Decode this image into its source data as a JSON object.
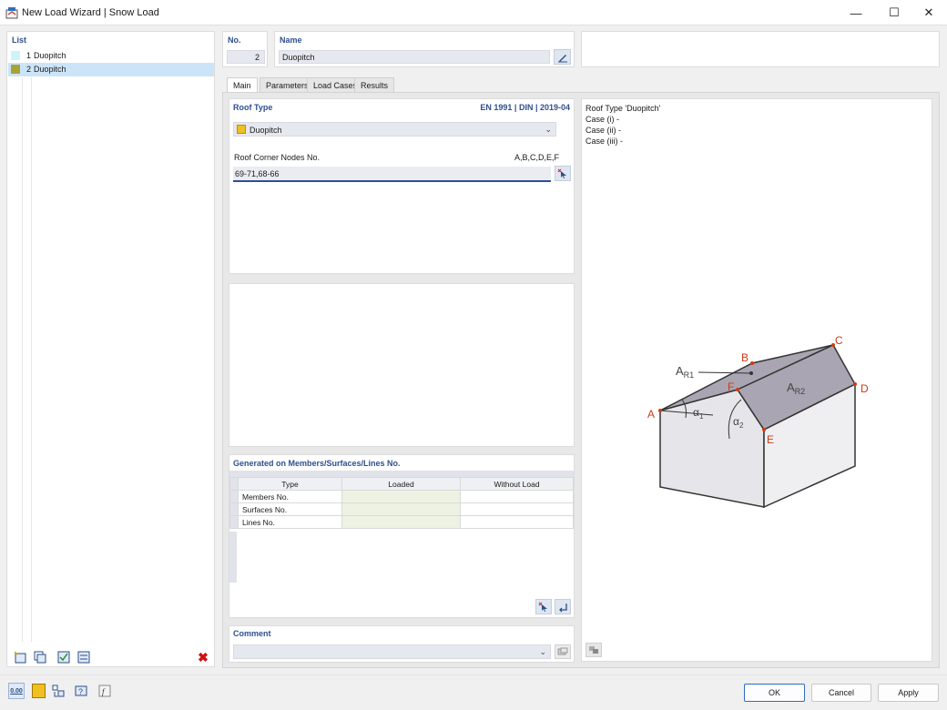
{
  "window": {
    "title": "New Load Wizard | Snow Load",
    "controls": {
      "minimize": "—",
      "maximize": "☐",
      "close": "✕"
    }
  },
  "list": {
    "header": "List",
    "items": [
      {
        "num": "1",
        "label": "Duopitch",
        "color": "#ccf5fb",
        "selected": false
      },
      {
        "num": "2",
        "label": "Duopitch",
        "color": "#a8a23a",
        "selected": true
      }
    ]
  },
  "fields": {
    "no_label": "No.",
    "no_value": "2",
    "name_label": "Name",
    "name_value": "Duopitch"
  },
  "tabs": [
    {
      "label": "Main",
      "active": true
    },
    {
      "label": "Parameters",
      "active": false
    },
    {
      "label": "Load Cases",
      "active": false
    },
    {
      "label": "Results",
      "active": false
    }
  ],
  "roof": {
    "header": "Roof Type",
    "norm": "EN 1991 | DIN | 2019-04",
    "type_value": "Duopitch",
    "type_color": "#f0c020",
    "corner_label": "Roof Corner Nodes No.",
    "corner_hint": "A,B,C,D,E,F",
    "corner_value": "69-71,68-66"
  },
  "generated": {
    "header": "Generated on Members/Surfaces/Lines No.",
    "columns": [
      "Type",
      "Loaded",
      "Without Load"
    ],
    "rows": [
      {
        "type": "Members No.",
        "loaded": "",
        "without": ""
      },
      {
        "type": "Surfaces No.",
        "loaded": "",
        "without": ""
      },
      {
        "type": "Lines No.",
        "loaded": "",
        "without": ""
      }
    ]
  },
  "comment": {
    "header": "Comment",
    "value": ""
  },
  "info": {
    "line1": "Roof Type 'Duopitch'",
    "line2": "Case (i) -",
    "line3": "Case (ii) -",
    "line4": "Case (iii) -"
  },
  "diagram": {
    "nodes": [
      "A",
      "B",
      "C",
      "D",
      "E",
      "F"
    ],
    "area1_main": "A",
    "area1_sub": "R1",
    "area2_main": "A",
    "area2_sub": "R2",
    "angle1_main": "α",
    "angle1_sub": "1",
    "angle2_main": "α",
    "angle2_sub": "2",
    "node_color": "#d03a12"
  },
  "bottom": {
    "units_icon_text": "0.00",
    "ok": "OK",
    "cancel": "Cancel",
    "apply": "Apply"
  }
}
